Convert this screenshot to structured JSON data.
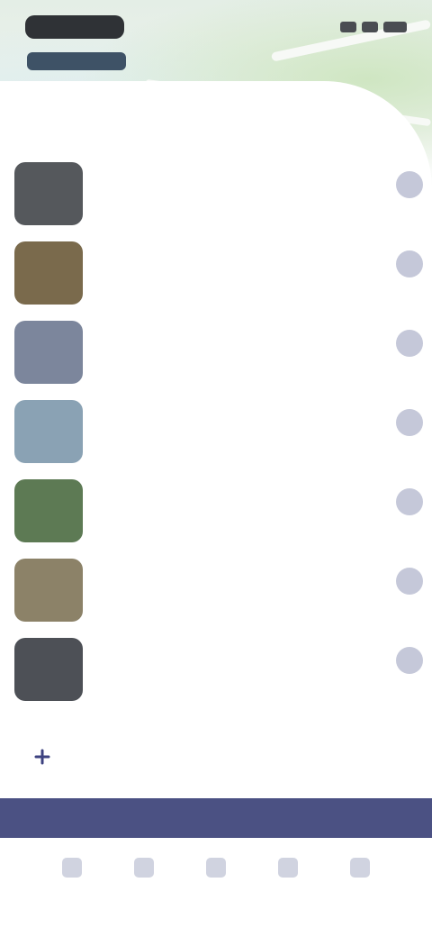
{
  "status_bar": {
    "time": "",
    "icons": [
      "signal-icon",
      "wifi-icon",
      "battery-icon"
    ]
  },
  "sheet": {
    "title": ""
  },
  "list": {
    "items": [
      {
        "text": "",
        "thumb_color": "#55585c",
        "action_icon": "chevron-right-icon"
      },
      {
        "text": "",
        "thumb_color": "#7a6a4c",
        "action_icon": "chevron-right-icon"
      },
      {
        "text": "",
        "thumb_color": "#7c869c",
        "action_icon": "chevron-right-icon"
      },
      {
        "text": "",
        "thumb_color": "#8aa2b4",
        "action_icon": "chevron-right-icon"
      },
      {
        "text": "",
        "thumb_color": "#5d7a54",
        "action_icon": "chevron-right-icon"
      },
      {
        "text": "",
        "thumb_color": "#8c8268",
        "action_icon": "chevron-right-icon"
      },
      {
        "text": "",
        "thumb_color": "#4d5056",
        "action_icon": "chevron-right-icon"
      }
    ]
  },
  "add_row": {
    "label": "",
    "icon": "plus-icon"
  },
  "tabs": [
    {
      "label": "",
      "icon": "home-icon"
    },
    {
      "label": "",
      "icon": "map-icon"
    },
    {
      "label": "",
      "icon": "list-icon"
    },
    {
      "label": "",
      "icon": "bookmark-icon"
    },
    {
      "label": "",
      "icon": "profile-icon"
    }
  ],
  "colors": {
    "accent": "#3d4280",
    "nav_bar": "#4b5183",
    "action": "#c5c8d9"
  }
}
